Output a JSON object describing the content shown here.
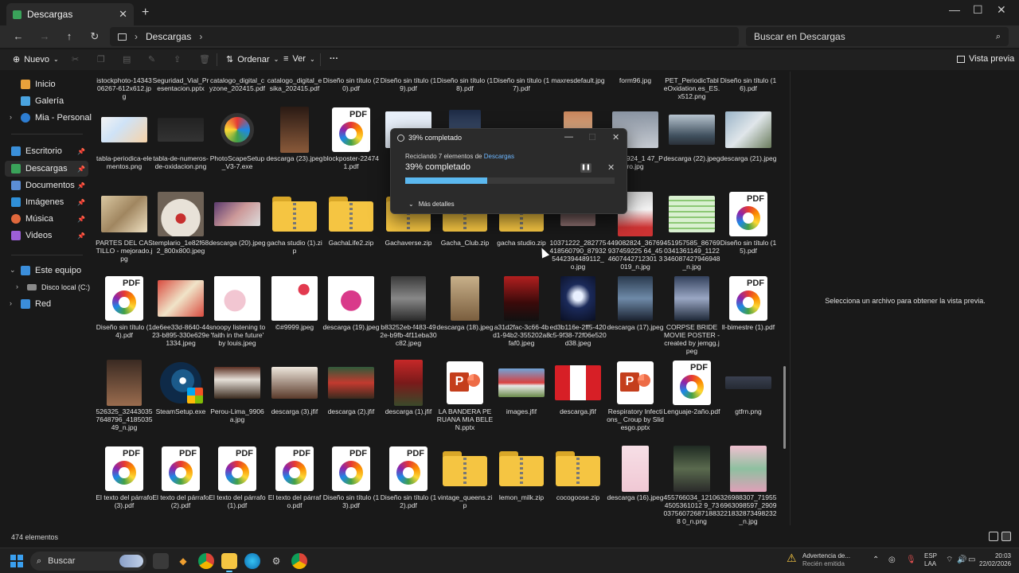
{
  "window": {
    "tab_label": "Descargas",
    "close_tab": "✕",
    "new_tab": "+",
    "minimize": "—",
    "maximize": "☐",
    "close": "✕"
  },
  "nav": {
    "back": "←",
    "forward": "→",
    "up": "↑",
    "refresh": "↻",
    "breadcrumb": "Descargas",
    "search_placeholder": "Buscar en Descargas"
  },
  "toolbar": {
    "new_label": "Nuevo",
    "sort_label": "Ordenar",
    "view_label": "Ver",
    "more_label": "···",
    "preview_label": "Vista previa"
  },
  "sidebar": {
    "items": [
      {
        "label": "Inicio",
        "color": "#e9a23b"
      },
      {
        "label": "Galería",
        "color": "#4aa3df"
      },
      {
        "label": "Mia - Personal",
        "color": "#2d7dd2"
      },
      {
        "label": "Escritorio",
        "color": "#3a8fd9"
      },
      {
        "label": "Descargas",
        "color": "#3aa35a"
      },
      {
        "label": "Documentos",
        "color": "#5b8dd6"
      },
      {
        "label": "Imágenes",
        "color": "#2f8fd8"
      },
      {
        "label": "Música",
        "color": "#e0683c"
      },
      {
        "label": "Videos",
        "color": "#9c5fd6"
      },
      {
        "label": "Este equipo",
        "color": "#3b8edb"
      },
      {
        "label": "Disco local (C:)",
        "color": "#8a8a8a"
      },
      {
        "label": "Red",
        "color": "#3b8edb"
      }
    ]
  },
  "files": {
    "row0": [
      "istockphoto-1434306267-612x612.jpg",
      "Seguridad_Vial_Presentacion.pptx",
      "catalogo_digital_cyzone_202415.pdf",
      "catalogo_digital_esika_202415.pdf",
      "Diseño sin título (20).pdf",
      "Diseño sin título (19).pdf",
      "Diseño sin título (18).pdf",
      "Diseño sin título (17).pdf",
      "maxresdefault.jpg",
      "form96.jpg",
      "PET_PeriodicTableOxidation.es_ES.x512.png",
      "Diseño sin título (16).pdf"
    ],
    "row1": [
      "tabla-periodica-elementos.png",
      "tabla-de-numeros-de-oxidacion.png",
      "PhotoScapeSetup_V3-7.exe",
      "descarga (23).jpeg",
      "blockposter-224741.pdf",
      "20240924_1 47_Pro.jpg",
      "descarga (22).jpeg",
      "descarga (21).jpeg"
    ],
    "row2": [
      "PARTES DEL CASTILLO - mejorado.jpg",
      "templario_1e82f682_800x800.jpeg",
      "descarga (20).jpeg",
      "gacha studio (1).zip",
      "GachaLife2.zip",
      "Gachaverse.zip",
      "Gacha_Club.zip",
      "gacha studio.zip",
      "10371222_282775418560790_879325442394489112_o.jpg",
      "449082824_36769937459225 64_454607442712301 3019_n.jpg",
      "451957585_867690341361149_1122346087427946948_n.jpg",
      "Diseño sin título (15).pdf"
    ],
    "row3": [
      "Diseño sin título (14).pdf",
      "de6ee33d-8640-4423-b895-330e629e1334.jpeg",
      "snoopy listening to 'faith in the future' by louis.jpeg",
      "©#9999.jpeg",
      "descarga (19).jpeg",
      "b83252eb-f483-492e-b9fb-4f11eba30c82.jpeg",
      "descarga (18).jpeg",
      "a31d2fac-3c66-4bd1-94b2-355202a8faf0.jpeg",
      "ed3b116e-2ff5-420c5-9f38-72f06e520d38.jpeg",
      "descarga (17).jpeg",
      "CORPSE BRIDE MOVIE POSTER - created by jemgg.jpeg",
      "ll-bimestre (1).pdf"
    ],
    "row4": [
      "526325_324430357648796_418503549_n.jpg",
      "SteamSetup.exe",
      "Perou-Lima_9906a.jpg",
      "descarga (3).jfif",
      "descarga (2).jfif",
      "descarga (1).jfif",
      "LA BANDERA PERUANA MIA BELEN.pptx",
      "images.jfif",
      "descarga.jfif",
      "Respiratory Infections_ Croup by Slidesgo.pptx",
      "Lenguaje-2año.pdf",
      "gtfrn.png"
    ],
    "row5": [
      "El texto del párrafo (3).pdf",
      "El texto del párrafo (2).pdf",
      "El texto del párrafo (1).pdf",
      "El texto del párrafo.pdf",
      "Diseño sin título (13).pdf",
      "Diseño sin título (12).pdf",
      "vintage_queens.zip",
      "lemon_milk.zip",
      "cocogoose.zip",
      "descarga (16).jpeg",
      "455766034_121064505361012 9_730375607268718838 0_n.png",
      "326988307_719556963098597_2909221832873498232_n.jpg"
    ]
  },
  "preview": {
    "message": "Selecciona un archivo para obtener la vista previa."
  },
  "status": {
    "count": "474 elementos"
  },
  "dialog": {
    "title": "39% completado",
    "line_prefix": "Reciclando 7 elementos de ",
    "line_link": "Descargas",
    "percent_text": "39% completado",
    "progress": 0.39,
    "more_details": "Más detalles",
    "pause": "❚❚",
    "cancel": "✕",
    "minimize": "—",
    "maximize": "☐",
    "close": "✕"
  },
  "taskbar": {
    "search_label": "Buscar",
    "warning_title": "Advertencia de...",
    "warning_sub": "Recién emitida",
    "lang_top": "ESP",
    "lang_bottom": "LAA",
    "time": "20:03",
    "date": "22/02/2026"
  }
}
